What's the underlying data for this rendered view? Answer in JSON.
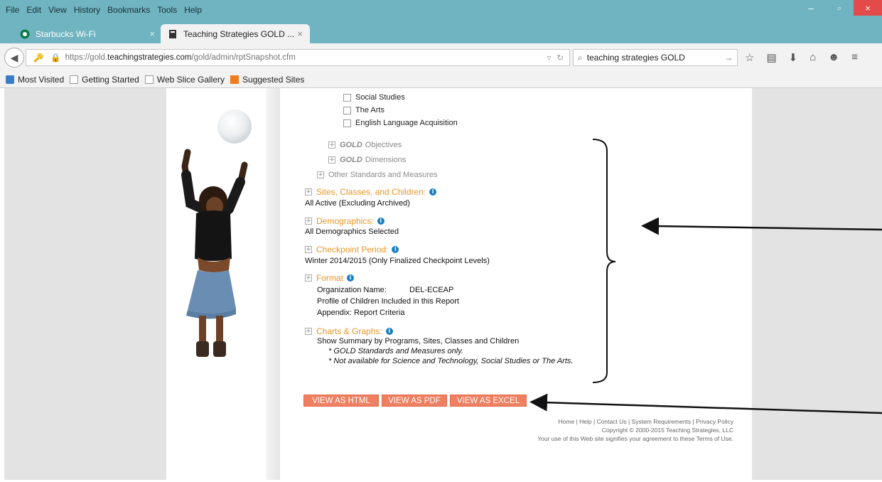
{
  "menu": [
    "File",
    "Edit",
    "View",
    "History",
    "Bookmarks",
    "Tools",
    "Help"
  ],
  "window_controls": {
    "minimize": "–",
    "maximize": "▫",
    "close": "×"
  },
  "tabs": [
    {
      "title": "Starbucks Wi-Fi",
      "close": "×"
    },
    {
      "title": "Teaching Strategies GOLD ...",
      "close": "×"
    }
  ],
  "new_tab_label": "+",
  "address": {
    "prefix": "https://gold.",
    "host": "teachingstrategies.com",
    "path": "/gold/admin/rptSnapshot.cfm"
  },
  "search": {
    "value": "teaching strategies GOLD"
  },
  "bookmarks": [
    "Most Visited",
    "Getting Started",
    "Web Slice Gallery",
    "Suggested Sites"
  ],
  "content_areas": [
    "Social Studies",
    "The Arts",
    "English Language Acquisition"
  ],
  "tree": {
    "gold_objectives": {
      "em": "GOLD",
      "rest": "Objectives"
    },
    "gold_dimensions": {
      "em": "GOLD",
      "rest": "Dimensions"
    },
    "other": "Other Standards and Measures"
  },
  "sections": {
    "sites": {
      "title": "Sites, Classes, and Children:",
      "value": "All Active (Excluding Archived)"
    },
    "demographics": {
      "title": "Demographics:",
      "value": "All Demographics Selected"
    },
    "checkpoint": {
      "title": "Checkpoint Period:",
      "value": "Winter 2014/2015 (Only Finalized Checkpoint Levels)"
    },
    "format": {
      "title": "Format",
      "org_label": "Organization Name:",
      "org_value": "DEL-ECEAP",
      "line2": "Profile of Children Included in this Report",
      "line3": "Appendix: Report Criteria"
    },
    "charts": {
      "title": "Charts & Graphs:",
      "value": "Show Summary by Programs, Sites, Classes and Children",
      "note1": "* GOLD Standards and Measures only.",
      "note2": "* Not available for Science and Technology, Social Studies or The Arts."
    }
  },
  "buttons": {
    "html": "VIEW AS HTML",
    "pdf": "VIEW AS PDF",
    "excel": "VIEW AS EXCEL"
  },
  "footer": {
    "links": "Home | Help | Contact Us | System Requirements | Privacy Policy",
    "copyright": "Copyright © 2000-2015 Teaching Strategies, LLC",
    "terms": "Your use of this Web site signifies your agreement to these Terms of Use."
  },
  "colors": {
    "chrome": "#6fb4c0",
    "accent": "#e8962b",
    "button": "#ef7f61",
    "info": "#1a7fc1"
  }
}
